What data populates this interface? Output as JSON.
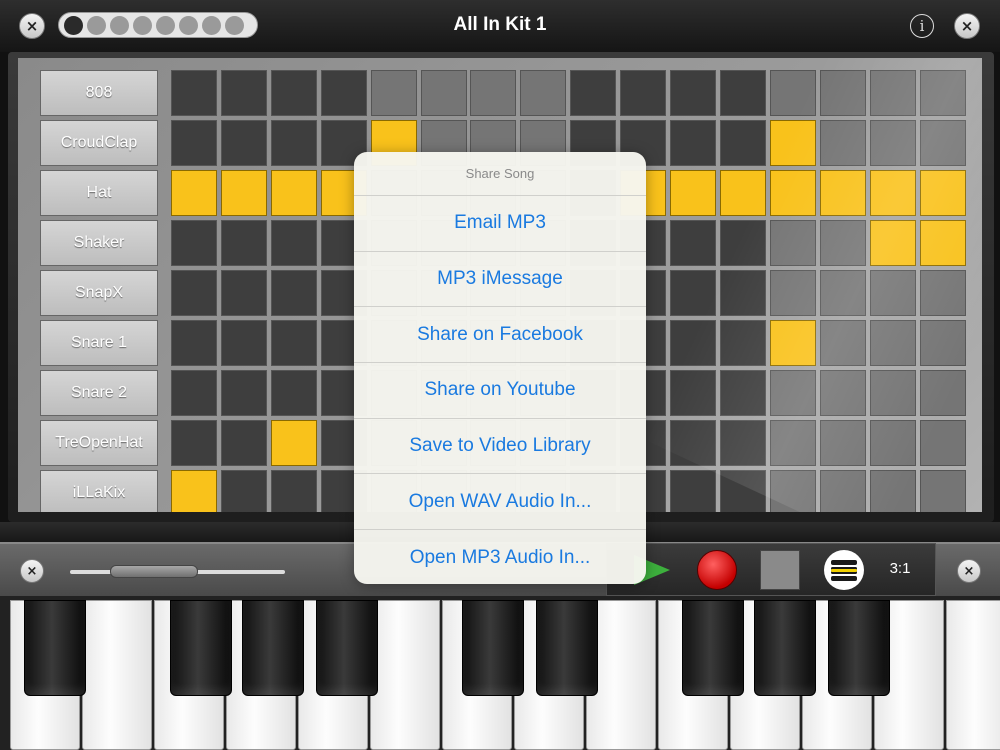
{
  "header": {
    "title": "All In Kit 1",
    "close_label": "×",
    "info_label": "i",
    "kit_pages": 8,
    "selected_kit_page": 1
  },
  "sequencer": {
    "tracks": [
      "808",
      "CroudClap",
      "Hat",
      "Shaker",
      "SnapX",
      "Snare 1",
      "Snare 2",
      "TreOpenHat",
      "iLLaKix"
    ],
    "steps_visible": 16,
    "active_steps": {
      "808": [],
      "CroudClap": [
        5,
        13
      ],
      "Hat": [
        1,
        2,
        3,
        4,
        10,
        11,
        12,
        13,
        14,
        15,
        16
      ],
      "Shaker": [
        15,
        16
      ],
      "SnapX": [],
      "Snare 1": [
        13
      ],
      "Snare 2": [],
      "TreOpenHat": [
        3
      ],
      "iLLaKix": [
        1
      ]
    }
  },
  "share_menu": {
    "title": "Share Song",
    "options": [
      "Email MP3",
      "MP3 iMessage",
      "Share on Facebook",
      "Share on Youtube",
      "Save to Video Library",
      "Open WAV Audio In...",
      "Open MP3 Audio In..."
    ]
  },
  "transport": {
    "ratio": "3:1",
    "icons": [
      "play-icon",
      "record-icon",
      "stop-icon",
      "menu-icon"
    ]
  },
  "keyboard": {
    "close_label": "×",
    "octave_slider_position": 0.35
  },
  "colors": {
    "step_on": "#f9c21b",
    "step_off_dark": "#3e3e3e",
    "step_off_light": "#757575",
    "link_blue": "#1a7ae0",
    "play_green": "#3db03d",
    "record_red": "#c40000"
  }
}
